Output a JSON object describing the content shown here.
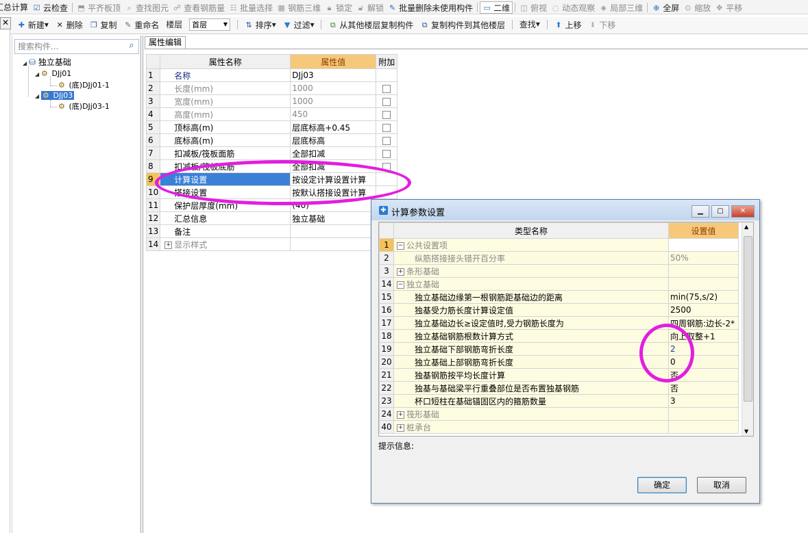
{
  "toolbar_top": {
    "items": [
      {
        "label": "汇总计算",
        "icon": "sum-icon",
        "disabled": false
      },
      {
        "label": "云检查",
        "icon": "cloud-check-icon",
        "disabled": false
      },
      {
        "label": "平齐板顶",
        "icon": "align-top-icon",
        "disabled": true
      },
      {
        "label": "查找图元",
        "icon": "find-icon",
        "disabled": true
      },
      {
        "label": "查看钢筋量",
        "icon": "rebar-view-icon",
        "disabled": true
      },
      {
        "label": "批量选择",
        "icon": "batch-select-icon",
        "disabled": true
      },
      {
        "label": "钢筋三维",
        "icon": "rebar-3d-icon",
        "disabled": true
      },
      {
        "label": "锁定",
        "icon": "lock-icon",
        "disabled": true
      },
      {
        "label": "解锁",
        "icon": "unlock-icon",
        "disabled": true
      },
      {
        "label": "批量删除未使用构件",
        "icon": "batch-delete-icon",
        "disabled": false
      },
      {
        "label": "二维",
        "icon": "2d-icon",
        "disabled": false
      },
      {
        "label": "俯视",
        "icon": "top-view-icon",
        "disabled": true
      },
      {
        "label": "动态观察",
        "icon": "orbit-icon",
        "disabled": true
      },
      {
        "label": "局部三维",
        "icon": "local-3d-icon",
        "disabled": true
      },
      {
        "label": "全屏",
        "icon": "fullscreen-icon",
        "disabled": false
      },
      {
        "label": "缩放",
        "icon": "zoom-icon",
        "disabled": true
      },
      {
        "label": "平移",
        "icon": "pan-icon",
        "disabled": true
      }
    ]
  },
  "toolbar_second": {
    "new": "新建",
    "delete": "删除",
    "copy": "复制",
    "rename": "重命名",
    "floor_label": "楼层",
    "floor_value": "首层",
    "sort": "排序",
    "filter": "过滤",
    "copy_from_floor": "从其他楼层复制构件",
    "copy_to_floor": "复制构件到其他楼层",
    "find": "查找",
    "move_up": "上移",
    "move_down": "下移"
  },
  "search": {
    "placeholder": "搜索构件..."
  },
  "tree": {
    "root": "独立基础",
    "nodes": [
      {
        "label": "DJj01",
        "child": "(底)DJj01-1"
      },
      {
        "label": "DJj03",
        "child": "(底)DJj03-1",
        "selected": true
      }
    ]
  },
  "attr_tab": {
    "label": "属性编辑"
  },
  "attr_table": {
    "headers": {
      "name": "属性名称",
      "value": "属性值",
      "extra": "附加"
    },
    "rows": [
      {
        "no": "1",
        "name": "名称",
        "value": "DJj03",
        "style": "blue",
        "checkbox": false
      },
      {
        "no": "2",
        "name": "长度(mm)",
        "value": "1000",
        "style": "gray",
        "checkbox": true
      },
      {
        "no": "3",
        "name": "宽度(mm)",
        "value": "1000",
        "style": "gray",
        "checkbox": true
      },
      {
        "no": "4",
        "name": "高度(mm)",
        "value": "450",
        "style": "gray",
        "checkbox": true
      },
      {
        "no": "5",
        "name": "顶标高(m)",
        "value": "层底标高+0.45",
        "style": "normal",
        "checkbox": true
      },
      {
        "no": "6",
        "name": "底标高(m)",
        "value": "层底标高",
        "style": "normal",
        "checkbox": true
      },
      {
        "no": "7",
        "name": "扣减板/筏板面筋",
        "value": "全部扣减",
        "style": "normal",
        "checkbox": true
      },
      {
        "no": "8",
        "name": "扣减板/筏板底筋",
        "value": "全部扣减",
        "style": "normal",
        "checkbox": true
      },
      {
        "no": "9",
        "name": "计算设置",
        "value": "按设定计算设置计算",
        "style": "selected",
        "checkbox": false
      },
      {
        "no": "10",
        "name": "搭接设置",
        "value": "按默认搭接设置计算",
        "style": "normal",
        "checkbox": false
      },
      {
        "no": "11",
        "name": "保护层厚度(mm)",
        "value": "(40)",
        "style": "normal",
        "checkbox": false
      },
      {
        "no": "12",
        "name": "汇总信息",
        "value": "独立基础",
        "style": "normal",
        "checkbox": false
      },
      {
        "no": "13",
        "name": "备注",
        "value": "",
        "style": "normal",
        "checkbox": false
      },
      {
        "no": "14",
        "name": "显示样式",
        "value": "",
        "style": "expand",
        "checkbox": false
      }
    ]
  },
  "dialog": {
    "title": "计算参数设置",
    "headers": {
      "type": "类型名称",
      "value": "设置值"
    },
    "rows": [
      {
        "no": "1",
        "name": "公共设置项",
        "value": "",
        "kind": "group-open",
        "highlight": true
      },
      {
        "no": "2",
        "name": "纵筋搭接接头错开百分率",
        "value": "50%",
        "kind": "child-gray"
      },
      {
        "no": "3",
        "name": "条形基础",
        "value": "",
        "kind": "group-closed"
      },
      {
        "no": "14",
        "name": "独立基础",
        "value": "",
        "kind": "group-open"
      },
      {
        "no": "15",
        "name": "独立基础边缘第一根钢筋距基础边的距离",
        "value": "min(75,s/2)",
        "kind": "child"
      },
      {
        "no": "16",
        "name": "独基受力筋长度计算设定值",
        "value": "2500",
        "kind": "child"
      },
      {
        "no": "17",
        "name": "独立基础边长≥设定值时,受力钢筋长度为",
        "value": "四周钢筋:边长-2*",
        "kind": "child"
      },
      {
        "no": "18",
        "name": "独立基础钢筋根数计算方式",
        "value": "向上取整+1",
        "kind": "child"
      },
      {
        "no": "19",
        "name": "独立基础下部钢筋弯折长度",
        "value": "2",
        "kind": "child-blue"
      },
      {
        "no": "20",
        "name": "独立基础上部钢筋弯折长度",
        "value": "0",
        "kind": "child"
      },
      {
        "no": "21",
        "name": "独基钢筋按平均长度计算",
        "value": "否",
        "kind": "child"
      },
      {
        "no": "22",
        "name": "独基与基础梁平行重叠部位是否布置独基钢筋",
        "value": "否",
        "kind": "child"
      },
      {
        "no": "23",
        "name": "杯口短柱在基础锚固区内的箍筋数量",
        "value": "3",
        "kind": "child"
      },
      {
        "no": "24",
        "name": "筏形基础",
        "value": "",
        "kind": "group-closed"
      },
      {
        "no": "40",
        "name": "桩承台",
        "value": "",
        "kind": "group-closed"
      }
    ],
    "hint_label": "提示信息:",
    "ok": "确定",
    "cancel": "取消"
  },
  "colors": {
    "annotation": "#e21ee0",
    "selection": "#3a80d8",
    "header_value_bg": "#f6c87a"
  }
}
